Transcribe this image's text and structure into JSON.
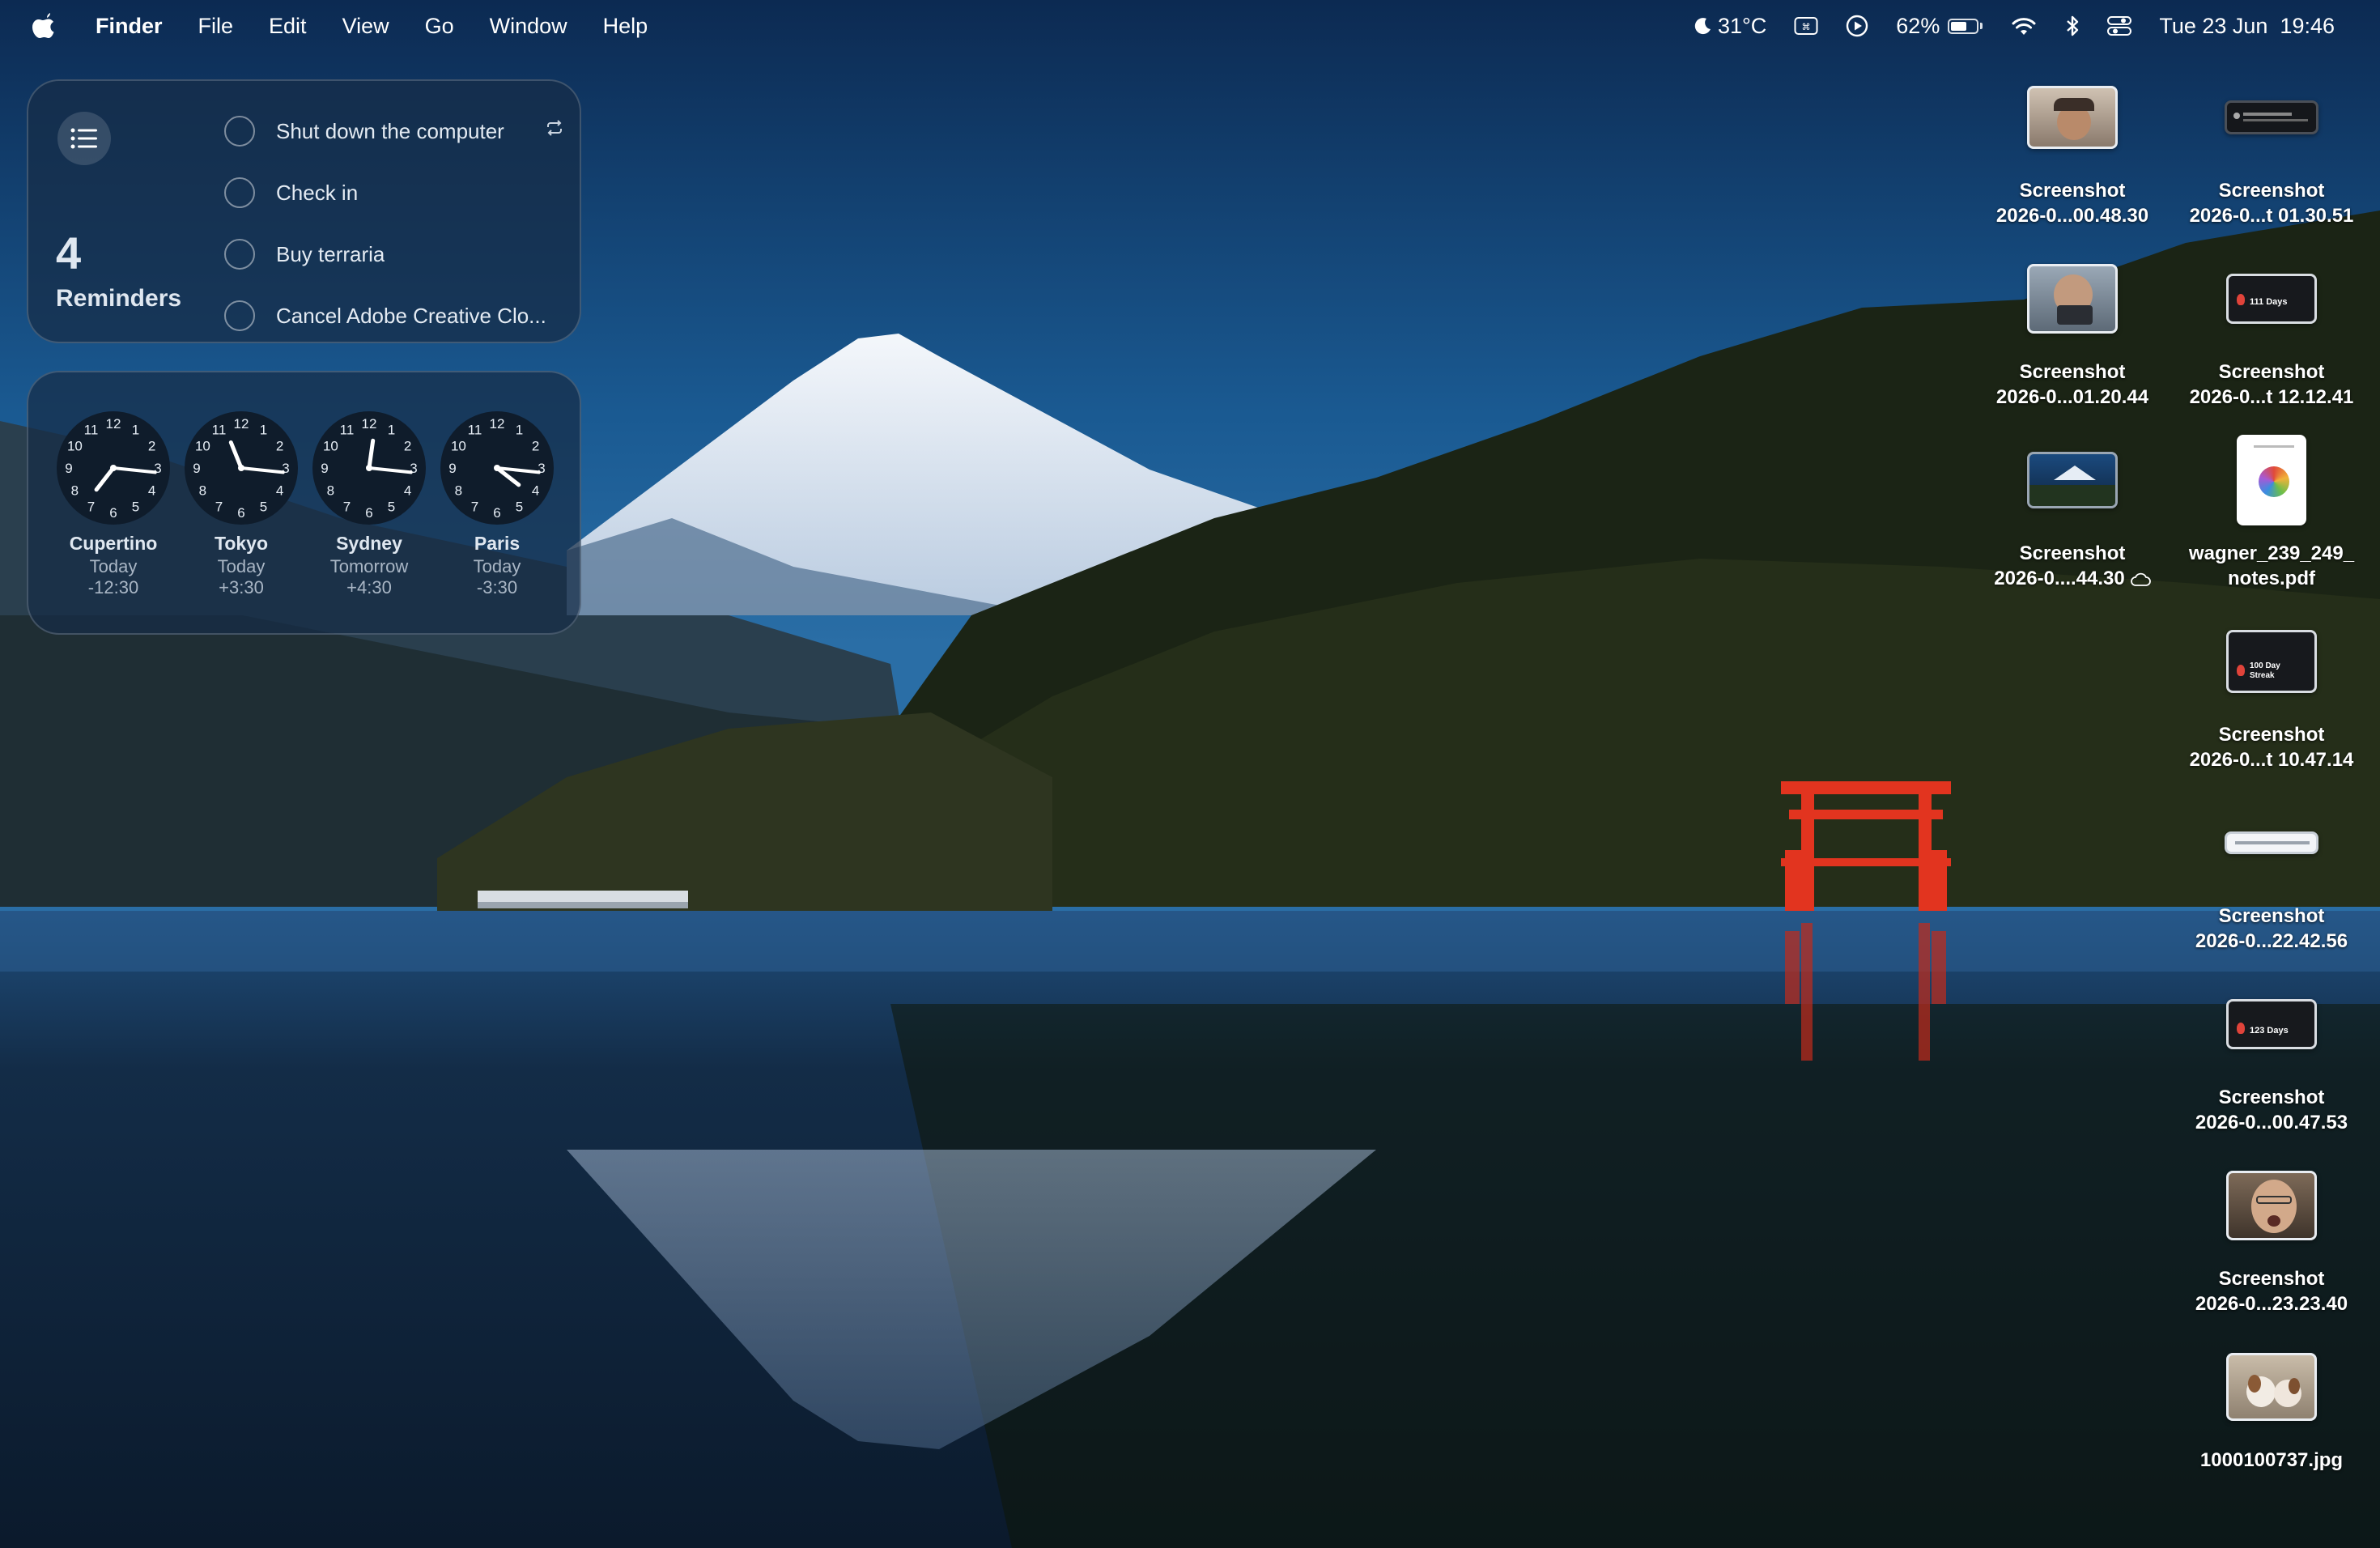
{
  "menubar": {
    "apple_icon": "apple-logo-icon",
    "items": [
      "Finder",
      "File",
      "Edit",
      "View",
      "Go",
      "Window",
      "Help"
    ],
    "status": {
      "weather": "31°C",
      "weather_icon": "moon-icon",
      "battery_percent": "62%",
      "battery_level": 0.62,
      "datetime": "Tue 23 Jun  19:46"
    }
  },
  "reminders_widget": {
    "count": "4",
    "title": "Reminders",
    "icon": "list-icon",
    "items": [
      {
        "text": "Shut down the computer",
        "repeats": true
      },
      {
        "text": "Check in"
      },
      {
        "text": "Buy terraria"
      },
      {
        "text": "Cancel Adobe Creative Clo..."
      }
    ]
  },
  "clock_widget": {
    "clocks": [
      {
        "city": "Cupertino",
        "day": "Today",
        "offset": "-12:30",
        "hour": 7,
        "minute": 16
      },
      {
        "city": "Tokyo",
        "day": "Today",
        "offset": "+3:30",
        "hour": 11,
        "minute": 16
      },
      {
        "city": "Sydney",
        "day": "Tomorrow",
        "offset": "+4:30",
        "hour": 12,
        "minute": 16
      },
      {
        "city": "Paris",
        "day": "Today",
        "offset": "-3:30",
        "hour": 4,
        "minute": 16
      }
    ]
  },
  "desktop_icons": [
    {
      "line1": "Screenshot",
      "line2": "2026-0...00.48.30",
      "kind": "photo-face"
    },
    {
      "line1": "Screenshot",
      "line2": "2026-0...t 01.30.51",
      "kind": "dark-wide"
    },
    {
      "line1": "Screenshot",
      "line2": "2026-0...01.20.44",
      "kind": "photo-face2"
    },
    {
      "line1": "Screenshot",
      "line2": "2026-0...t 12.12.41",
      "kind": "streak",
      "streak_text": "111 Days"
    },
    {
      "line1": "Screenshot",
      "line2": "2026-0....44.30",
      "kind": "landscape",
      "icloud": true
    },
    {
      "line1": "wagner_239_249_",
      "line2": "notes.pdf",
      "kind": "pdf"
    },
    {
      "line1": "Screenshot",
      "line2": "2026-0...t 10.47.14",
      "kind": "streak",
      "streak_text": "100 Day Streak"
    },
    {
      "line1": "Screenshot",
      "line2": "2026-0...22.42.56",
      "kind": "bar"
    },
    {
      "line1": "Screenshot",
      "line2": "2026-0...00.47.53",
      "kind": "streak",
      "streak_text": "123 Days"
    },
    {
      "line1": "Screenshot",
      "line2": "2026-0...23.23.40",
      "kind": "photo-face3"
    },
    {
      "line1": "1000100737.jpg",
      "line2": "",
      "kind": "dog-photo"
    }
  ]
}
